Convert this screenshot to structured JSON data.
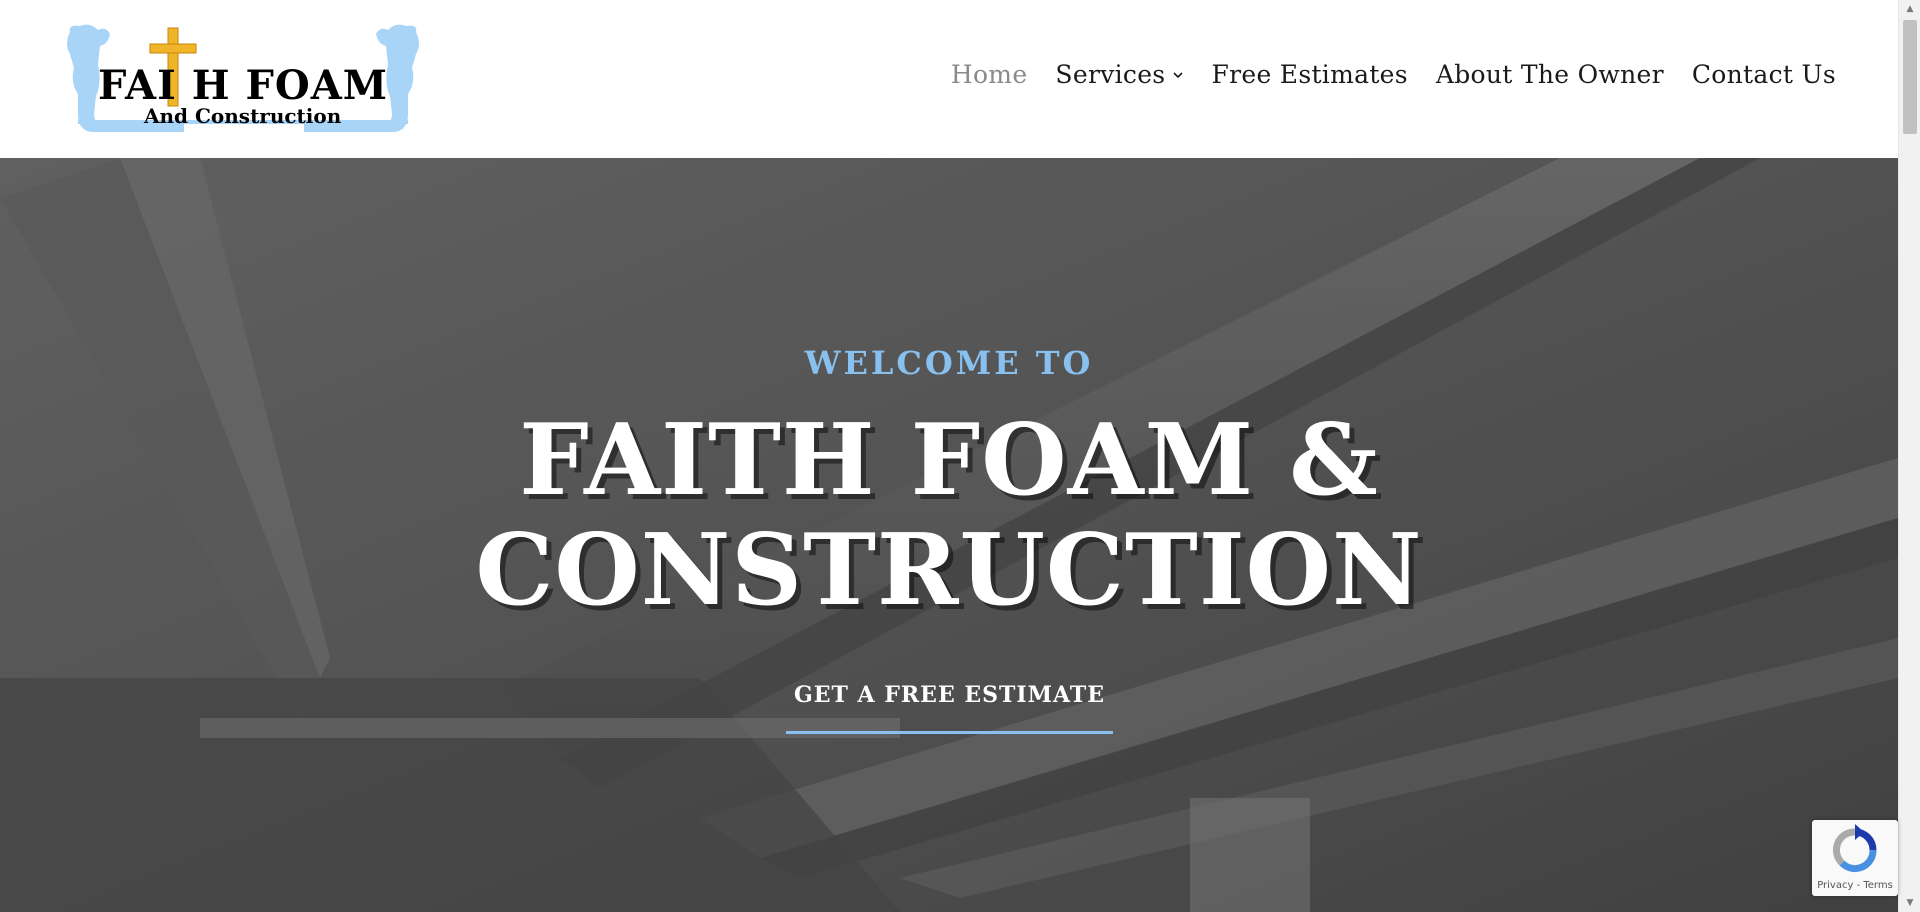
{
  "brand": {
    "logo_title": "FAI H FOAM",
    "logo_subtitle": "And Construction",
    "logo_colors": {
      "accent": "#f0b429",
      "foam": "#a8d4f8"
    }
  },
  "nav": {
    "items": [
      {
        "label": "Home",
        "active": true
      },
      {
        "label": "Services",
        "has_dropdown": true
      },
      {
        "label": "Free Estimates"
      },
      {
        "label": "About The Owner"
      },
      {
        "label": "Contact Us"
      }
    ]
  },
  "hero": {
    "welcome": "WELCOME TO",
    "title_line1": "FAITH FOAM &",
    "title_line2": "CONSTRUCTION",
    "cta_label": "GET A FREE ESTIMATE",
    "accent_color": "#88c0f0"
  },
  "recaptcha": {
    "links": "Privacy - Terms",
    "icon": "recaptcha-icon"
  }
}
